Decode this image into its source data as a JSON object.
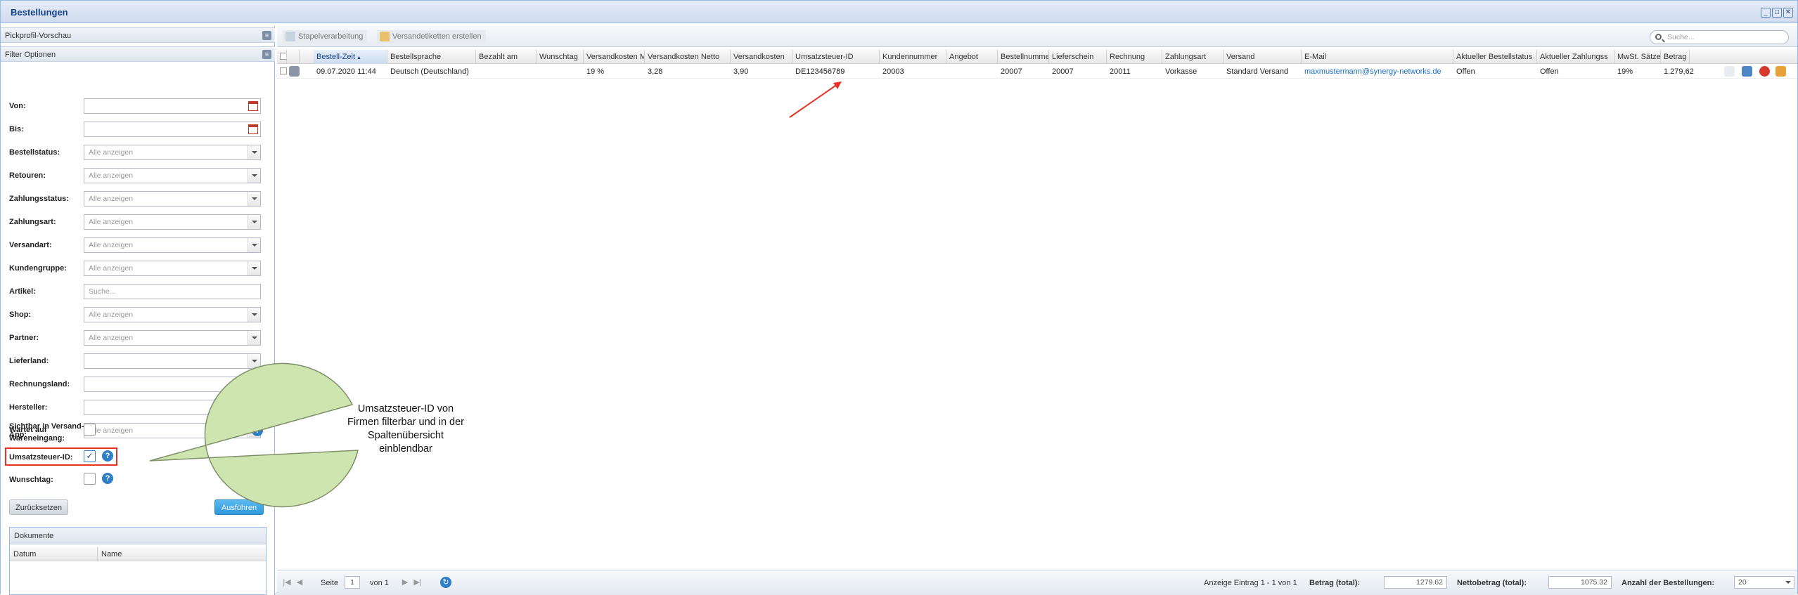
{
  "window": {
    "title": "Bestellungen"
  },
  "left": {
    "pickprofil": "Pickprofil-Vorschau",
    "filter_title": "Filter Optionen",
    "filters": [
      {
        "label": "Von:",
        "value": "",
        "type": "date"
      },
      {
        "label": "Bis:",
        "value": "",
        "type": "date"
      },
      {
        "label": "Bestellstatus:",
        "value": "Alle anzeigen",
        "type": "select"
      },
      {
        "label": "Retouren:",
        "value": "Alle anzeigen",
        "type": "select"
      },
      {
        "label": "Zahlungsstatus:",
        "value": "Alle anzeigen",
        "type": "select"
      },
      {
        "label": "Zahlungsart:",
        "value": "Alle anzeigen",
        "type": "select"
      },
      {
        "label": "Versandart:",
        "value": "Alle anzeigen",
        "type": "select"
      },
      {
        "label": "Kundengruppe:",
        "value": "Alle anzeigen",
        "type": "select"
      },
      {
        "label": "Artikel:",
        "value": "Suche...",
        "type": "text"
      },
      {
        "label": "Shop:",
        "value": "Alle anzeigen",
        "type": "select"
      },
      {
        "label": "Partner:",
        "value": "Alle anzeigen",
        "type": "select"
      },
      {
        "label": "Lieferland:",
        "value": "",
        "type": "select"
      },
      {
        "label": "Rechnungsland:",
        "value": "",
        "type": "select"
      },
      {
        "label": "Hersteller:",
        "value": "",
        "type": "select"
      },
      {
        "label": "Sichtbar in Versand-App:",
        "value": "Alle anzeigen",
        "type": "select"
      }
    ],
    "wartet_label": "Wartet auf Wareneingang:",
    "ust_label": "Umsatzsteuer-ID:",
    "wunsch_label": "Wunschtag:",
    "reset_label": "Zurücksetzen",
    "run_label": "Ausführen",
    "docs_title": "Dokumente",
    "docs_col_date": "Datum",
    "docs_col_name": "Name"
  },
  "toolbar": {
    "batch_label": "Stapelverarbeitung",
    "labels_label": "Versandetiketten erstellen",
    "search_placeholder": "Suche..."
  },
  "grid": {
    "columns": [
      "Bestell-Zeit",
      "Bestellsprache",
      "Bezahlt am",
      "Wunschtag",
      "Versandkosten MwSt.",
      "Versandkosten Netto",
      "Versandkosten",
      "Umsatzsteuer-ID",
      "Kundennummer",
      "Angebot",
      "Bestellnummer",
      "Lieferschein",
      "Rechnung",
      "Zahlungsart",
      "Versand",
      "E-Mail",
      "Aktueller Bestellstatus",
      "Aktueller Zahlungss",
      "MwSt. Sätze",
      "Betrag"
    ],
    "row": [
      "09.07.2020 11:44",
      "Deutsch (Deutschland)",
      "",
      "",
      "19 %",
      "3,28",
      "3,90",
      "DE123456789",
      "20003",
      "",
      "20007",
      "20007",
      "20011",
      "Vorkasse",
      "Standard Versand",
      "maxmustermann@synergy-networks.de",
      "Offen",
      "Offen",
      "19%",
      "1.279,62"
    ]
  },
  "pager": {
    "page_label": "Seite",
    "page_value": "1",
    "of_label": "von 1",
    "display": "Anzeige Eintrag 1 - 1 von 1",
    "total_label": "Betrag (total):",
    "total_value": "1279.62",
    "net_label": "Nettobetrag (total):",
    "net_value": "1075.32",
    "count_label": "Anzahl der Bestellungen:",
    "count_value": "20"
  },
  "callout": {
    "text": "Umsatzsteuer-ID von Firmen filterbar und in der Spaltenübersicht einblendbar"
  },
  "colors": {
    "accent": "#3aa6e8",
    "highlight": "#e53223",
    "callout_fill": "#cfe5b0"
  }
}
